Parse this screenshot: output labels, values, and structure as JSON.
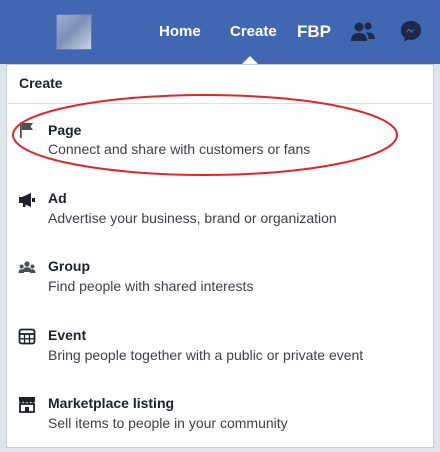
{
  "topbar": {
    "nav": {
      "home": "Home",
      "create": "Create",
      "fbp": "FBP"
    },
    "icons": {
      "friends": "friends-icon",
      "messenger": "messenger-icon"
    },
    "color": "#4267b2"
  },
  "dropdown": {
    "title": "Create",
    "items": [
      {
        "icon": "flag-icon",
        "title": "Page",
        "description": "Connect and share with customers or fans"
      },
      {
        "icon": "megaphone-icon",
        "title": "Ad",
        "description": "Advertise your business, brand or organization"
      },
      {
        "icon": "group-icon",
        "title": "Group",
        "description": "Find people with shared interests"
      },
      {
        "icon": "calendar-icon",
        "title": "Event",
        "description": "Bring people together with a public or private event"
      },
      {
        "icon": "storefront-icon",
        "title": "Marketplace listing",
        "description": "Sell items to people in your community"
      }
    ]
  },
  "annotation": {
    "color": "#e0262b",
    "highlighted_item": "Page"
  }
}
